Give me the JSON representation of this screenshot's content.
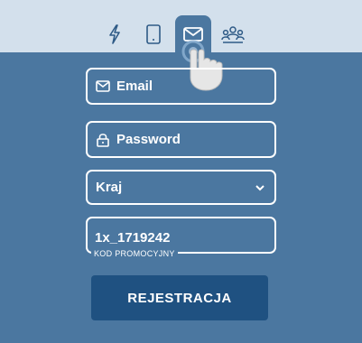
{
  "tabs": [
    {
      "icon": "lightning-icon",
      "active": false
    },
    {
      "icon": "phone-icon",
      "active": false
    },
    {
      "icon": "envelope-icon",
      "active": true
    },
    {
      "icon": "group-icon",
      "active": false
    }
  ],
  "form": {
    "email_label": "Email",
    "password_label": "Password",
    "country_label": "Kraj",
    "promo_value": "1x_1719242",
    "promo_caption": "KOD PROMOCYJNY",
    "submit_label": "REJESTRACJA"
  },
  "colors": {
    "background": "#4b77a0",
    "tabbar": "#d3e0ec",
    "tab_icon": "#2e5a86",
    "button": "#1f5181"
  }
}
